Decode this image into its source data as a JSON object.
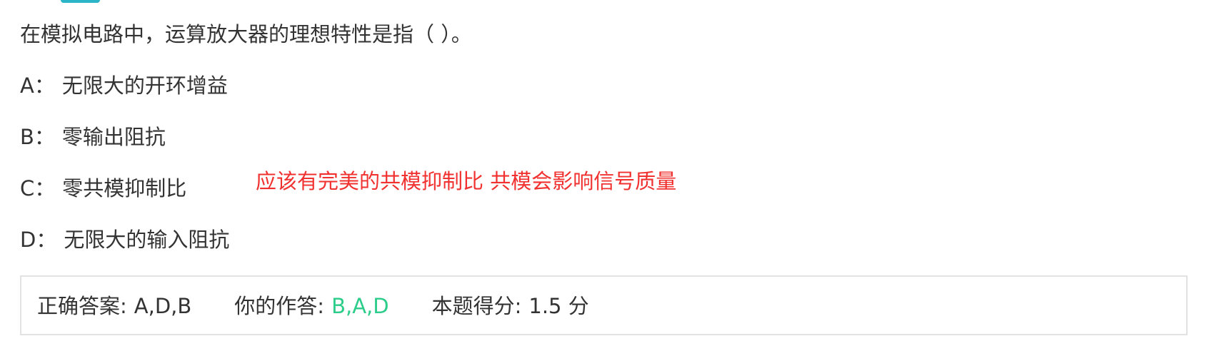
{
  "question": {
    "title": "在模拟电路中，运算放大器的理想特性是指（ ）。",
    "options": [
      {
        "key": "A：",
        "text": "无限大的开环增益"
      },
      {
        "key": "B：",
        "text": "零输出阻抗"
      },
      {
        "key": "C：",
        "text": "零共模抑制比"
      },
      {
        "key": "D：",
        "text": "无限大的输入阻抗"
      }
    ],
    "annotation": "应该有完美的共模抑制比 共模会影响信号质量"
  },
  "result": {
    "correct_label": "正确答案:",
    "correct_value": "A,D,B",
    "user_label": "你的作答:",
    "user_value": "B,A,D",
    "score_label": "本题得分:",
    "score_value": "1.5 分"
  },
  "colors": {
    "annotation": "#f0312f",
    "user_answer": "#2ccc8a",
    "accent_tab": "#2bb5c8"
  }
}
